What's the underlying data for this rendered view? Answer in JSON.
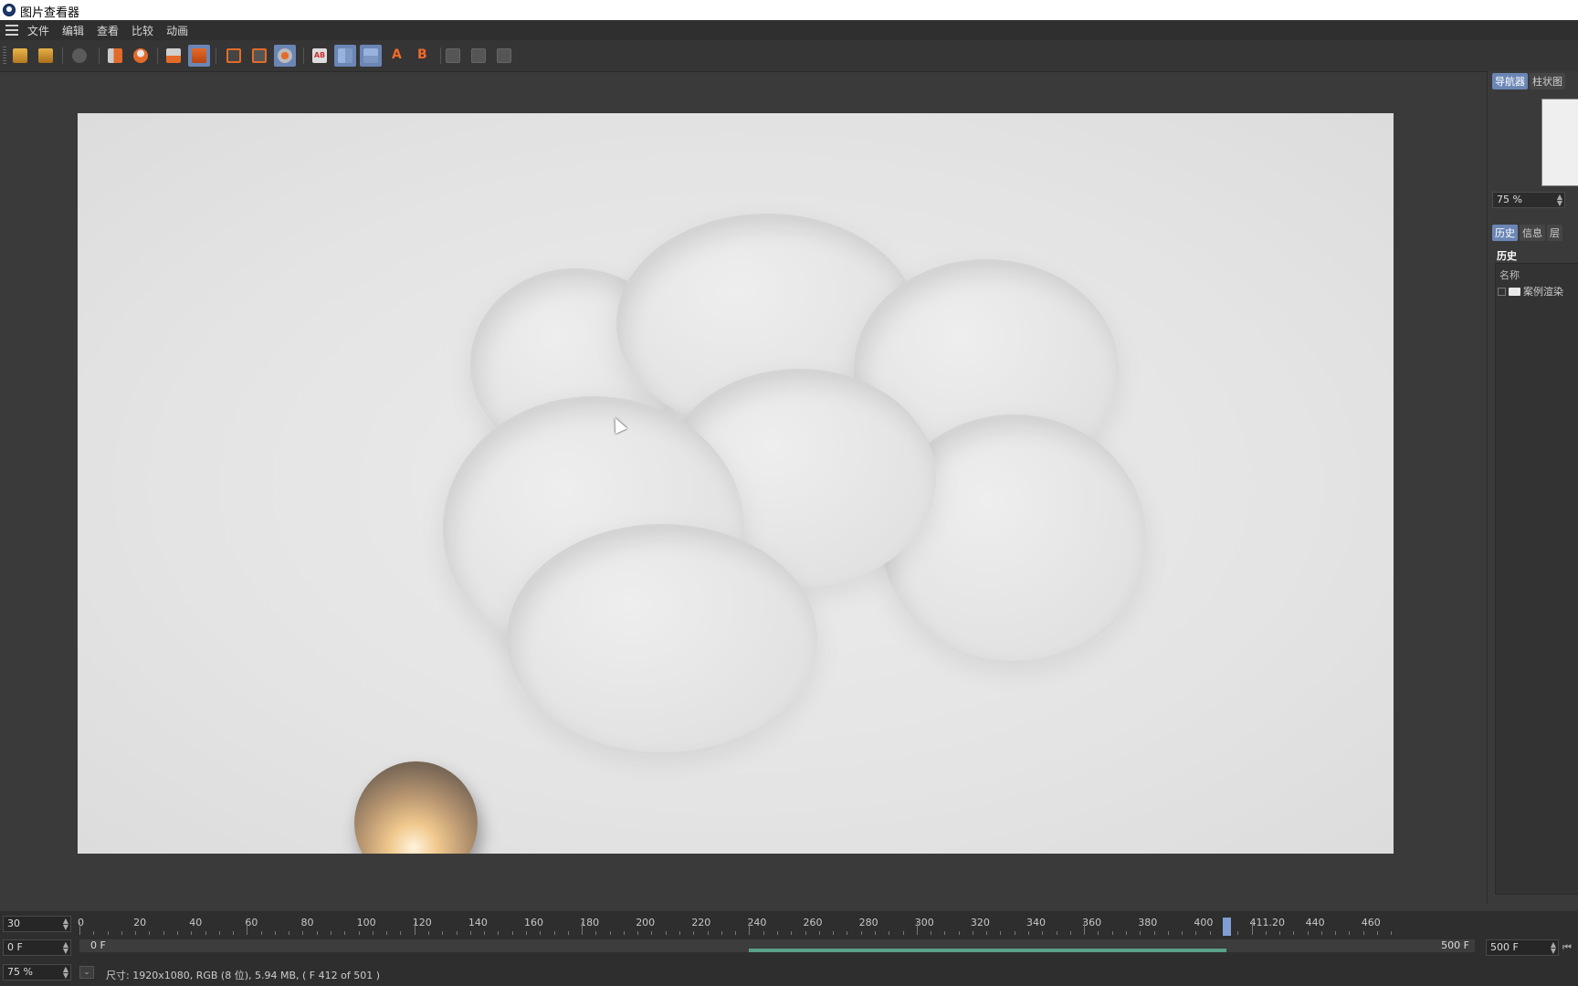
{
  "window": {
    "title": "图片查看器"
  },
  "menu": [
    "文件",
    "编辑",
    "查看",
    "比较",
    "动画"
  ],
  "toolbar": {
    "icons": [
      "open-icon",
      "save-icon",
      "gear-icon",
      "crop-icon",
      "person-icon",
      "stack-icon",
      "stack-red-icon",
      "frame-icon",
      "frame-eye-icon",
      "group-icon",
      "ab-icon",
      "split-a-icon",
      "split-b-icon",
      "set-a-icon",
      "set-b-icon",
      "grid1-icon",
      "grid2-icon",
      "grid3-icon"
    ],
    "ab_text": "AB",
    "a_text": "A",
    "b_text": "B"
  },
  "right_panel": {
    "top_tabs": [
      "导航器",
      "柱状图"
    ],
    "zoom": "75 %",
    "bottom_tabs": [
      "历史",
      "信息",
      "层"
    ],
    "history_title": "历史",
    "history_column": "名称",
    "history_item": "案例渲染"
  },
  "timeline": {
    "fps": "30",
    "current_frame": "0 F",
    "start_label": "0 F",
    "end_label": "500 F",
    "end_field": "500 F",
    "zoom": "75 %",
    "ruler_labels": [
      "0",
      "20",
      "40",
      "60",
      "80",
      "100",
      "120",
      "140",
      "160",
      "180",
      "200",
      "220",
      "240",
      "260",
      "280",
      "300",
      "320",
      "340",
      "360",
      "380",
      "400",
      "411.20",
      "440",
      "460"
    ],
    "playhead_frame": 411,
    "max_frame": 500,
    "rendered_from": 240,
    "status": "尺寸: 1920x1080, RGB (8 位), 5.94 MB, ( F 412 of 501 )"
  },
  "colors": {
    "accent": "#6b86b5",
    "rendered": "#5aa08b"
  }
}
